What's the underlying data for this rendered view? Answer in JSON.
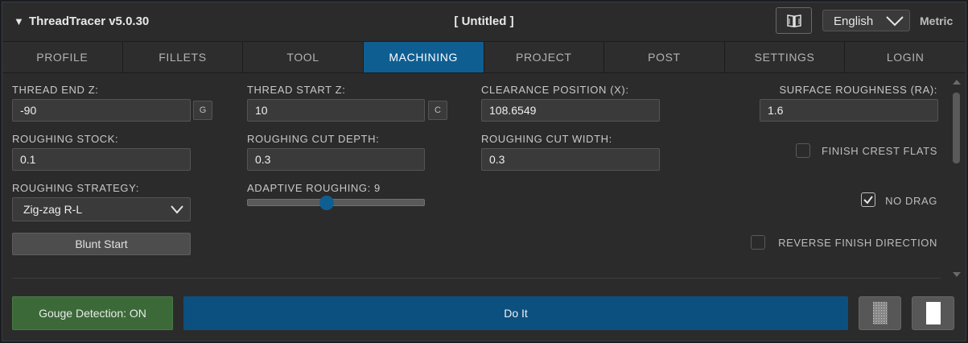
{
  "window": {
    "collapse_glyph": "▼",
    "app_title": "ThreadTracer v5.0.30",
    "document_title": "[ Untitled ]",
    "help_icon": "book-icon",
    "language": "English",
    "units": "Metric"
  },
  "tabs": [
    {
      "label": "PROFILE",
      "active": false
    },
    {
      "label": "FILLETS",
      "active": false
    },
    {
      "label": "TOOL",
      "active": false
    },
    {
      "label": "MACHINING",
      "active": true
    },
    {
      "label": "PROJECT",
      "active": false
    },
    {
      "label": "POST",
      "active": false
    },
    {
      "label": "SETTINGS",
      "active": false
    },
    {
      "label": "LOGIN",
      "active": false
    }
  ],
  "form": {
    "thread_end_z": {
      "label": "THREAD END Z:",
      "value": "-90",
      "button": "G"
    },
    "thread_start_z": {
      "label": "THREAD START Z:",
      "value": "10",
      "button": "C"
    },
    "clearance_position": {
      "label": "CLEARANCE POSITION (X):",
      "value": "108.6549"
    },
    "surface_roughness": {
      "label": "SURFACE ROUGHNESS (RA):",
      "value": "1.6"
    },
    "roughing_stock": {
      "label": "ROUGHING STOCK:",
      "value": "0.1"
    },
    "roughing_cut_depth": {
      "label": "ROUGHING CUT DEPTH:",
      "value": "0.3"
    },
    "roughing_cut_width": {
      "label": "ROUGHING CUT WIDTH:",
      "value": "0.3"
    },
    "roughing_strategy": {
      "label": "ROUGHING STRATEGY:",
      "value": "Zig-zag R-L"
    },
    "adaptive_roughing": {
      "label": "ADAPTIVE ROUGHING: 9",
      "fraction": 0.45
    },
    "blunt_start_label": "Blunt Start",
    "finish_crest_flats": {
      "label": "FINISH CREST FLATS",
      "checked": false
    },
    "no_drag": {
      "label": "NO DRAG",
      "checked": true
    },
    "reverse_finish_direction": {
      "label": "REVERSE FINISH DIRECTION",
      "checked": false
    }
  },
  "footer": {
    "gouge_detection_label": "Gouge Detection: ON",
    "do_it_label": "Do It",
    "icon_buttons": [
      "pattern-icon",
      "portrait-page-icon"
    ]
  },
  "colors": {
    "accent_blue": "#0f5e92",
    "gouge_green": "#3b6a38",
    "do_it_blue": "#0c5080",
    "panel_bg": "#2b2b2b"
  }
}
